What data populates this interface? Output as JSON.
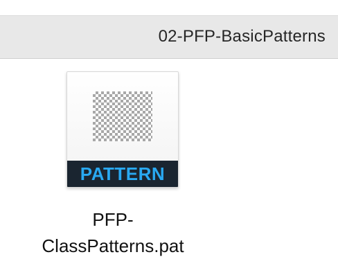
{
  "path_bar": {
    "folder_name": "02-PFP-BasicPatterns"
  },
  "file": {
    "icon_label": "PATTERN",
    "name_line1": "PFP-",
    "name_line2": "ClassPatterns.pat",
    "icon_name": "pattern-file-icon",
    "accent_color": "#29a9f2",
    "band_color": "#1a2530"
  }
}
